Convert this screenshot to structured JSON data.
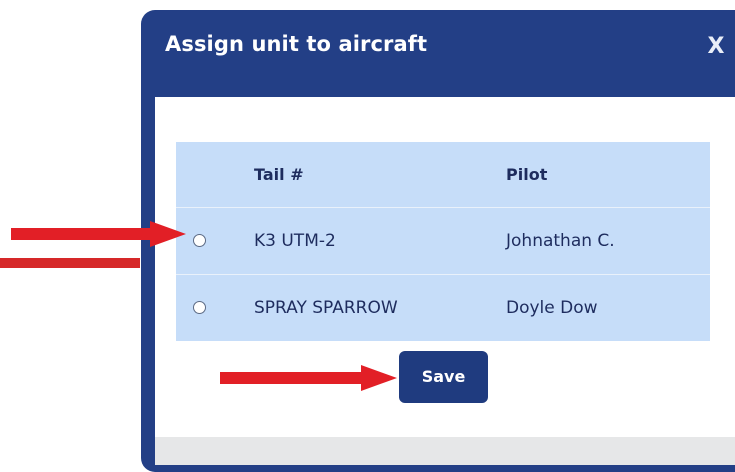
{
  "dialog": {
    "title": "Assign unit to aircraft",
    "close_label": "X"
  },
  "table": {
    "columns": [
      "Tail #",
      "Pilot"
    ],
    "rows": [
      {
        "tail": "K3 UTM-2",
        "pilot": "Johnathan C.",
        "selected": false
      },
      {
        "tail": "SPRAY SPARROW",
        "pilot": "Doyle Dow",
        "selected": false
      }
    ]
  },
  "actions": {
    "save_label": "Save"
  },
  "colors": {
    "dialog_header": "#233f86",
    "table_background": "#c6ddf9",
    "button": "#1f3b7f",
    "annotation_arrow": "#e21f26"
  },
  "annotations": [
    {
      "type": "arrow",
      "points_to": "radio-k3-utm-2"
    },
    {
      "type": "arrow",
      "points_to": "save-button"
    }
  ]
}
